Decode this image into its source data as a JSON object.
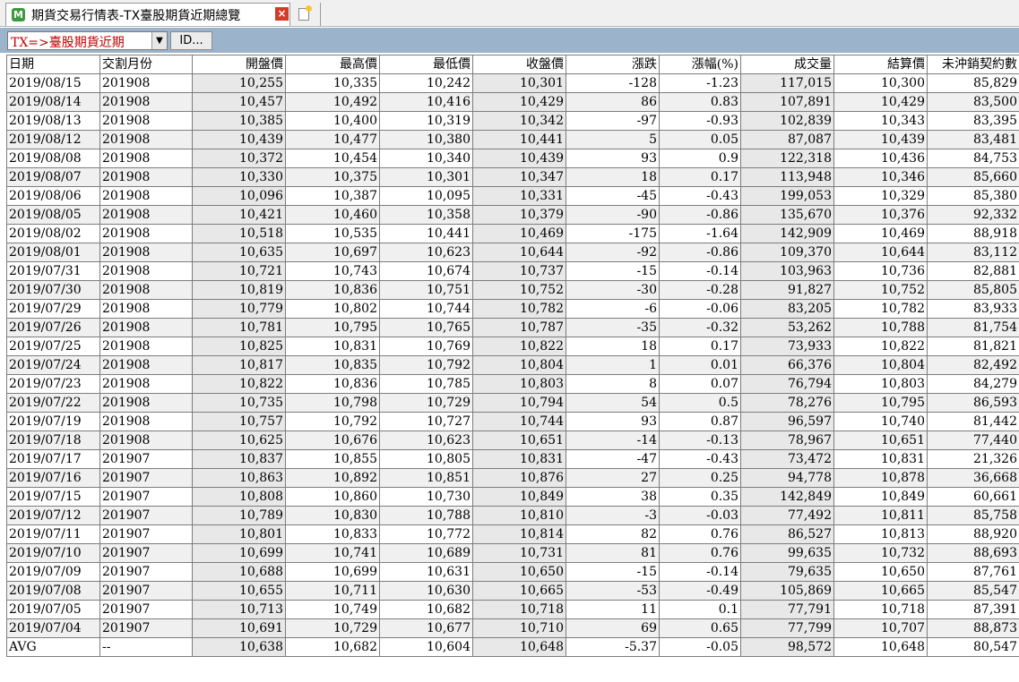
{
  "window": {
    "tab_title": "期貨交易行情表-TX臺股期貨近期總覽",
    "tab_icon": "M",
    "close_glyph": "×"
  },
  "toolbar": {
    "contract_select_value": "TX=>臺股期貨近期",
    "dropdown_arrow": "▼",
    "id_button_label": "ID..."
  },
  "table": {
    "columns": [
      "日期",
      "交割月份",
      "開盤價",
      "最高價",
      "最低價",
      "收盤價",
      "漲跌",
      "漲幅(%)",
      "成交量",
      "結算價",
      "未沖銷契約數"
    ],
    "rows": [
      [
        "2019/08/15",
        "201908",
        "10,255",
        "10,335",
        "10,242",
        "10,301",
        "-128",
        "-1.23",
        "117,015",
        "10,300",
        "85,829"
      ],
      [
        "2019/08/14",
        "201908",
        "10,457",
        "10,492",
        "10,416",
        "10,429",
        "86",
        "0.83",
        "107,891",
        "10,429",
        "83,500"
      ],
      [
        "2019/08/13",
        "201908",
        "10,385",
        "10,400",
        "10,319",
        "10,342",
        "-97",
        "-0.93",
        "102,839",
        "10,343",
        "83,395"
      ],
      [
        "2019/08/12",
        "201908",
        "10,439",
        "10,477",
        "10,380",
        "10,441",
        "5",
        "0.05",
        "87,087",
        "10,439",
        "83,481"
      ],
      [
        "2019/08/08",
        "201908",
        "10,372",
        "10,454",
        "10,340",
        "10,439",
        "93",
        "0.9",
        "122,318",
        "10,436",
        "84,753"
      ],
      [
        "2019/08/07",
        "201908",
        "10,330",
        "10,375",
        "10,301",
        "10,347",
        "18",
        "0.17",
        "113,948",
        "10,346",
        "85,660"
      ],
      [
        "2019/08/06",
        "201908",
        "10,096",
        "10,387",
        "10,095",
        "10,331",
        "-45",
        "-0.43",
        "199,053",
        "10,329",
        "85,380"
      ],
      [
        "2019/08/05",
        "201908",
        "10,421",
        "10,460",
        "10,358",
        "10,379",
        "-90",
        "-0.86",
        "135,670",
        "10,376",
        "92,332"
      ],
      [
        "2019/08/02",
        "201908",
        "10,518",
        "10,535",
        "10,441",
        "10,469",
        "-175",
        "-1.64",
        "142,909",
        "10,469",
        "88,918"
      ],
      [
        "2019/08/01",
        "201908",
        "10,635",
        "10,697",
        "10,623",
        "10,644",
        "-92",
        "-0.86",
        "109,370",
        "10,644",
        "83,112"
      ],
      [
        "2019/07/31",
        "201908",
        "10,721",
        "10,743",
        "10,674",
        "10,737",
        "-15",
        "-0.14",
        "103,963",
        "10,736",
        "82,881"
      ],
      [
        "2019/07/30",
        "201908",
        "10,819",
        "10,836",
        "10,751",
        "10,752",
        "-30",
        "-0.28",
        "91,827",
        "10,752",
        "85,805"
      ],
      [
        "2019/07/29",
        "201908",
        "10,779",
        "10,802",
        "10,744",
        "10,782",
        "-6",
        "-0.06",
        "83,205",
        "10,782",
        "83,933"
      ],
      [
        "2019/07/26",
        "201908",
        "10,781",
        "10,795",
        "10,765",
        "10,787",
        "-35",
        "-0.32",
        "53,262",
        "10,788",
        "81,754"
      ],
      [
        "2019/07/25",
        "201908",
        "10,825",
        "10,831",
        "10,769",
        "10,822",
        "18",
        "0.17",
        "73,933",
        "10,822",
        "81,821"
      ],
      [
        "2019/07/24",
        "201908",
        "10,817",
        "10,835",
        "10,792",
        "10,804",
        "1",
        "0.01",
        "66,376",
        "10,804",
        "82,492"
      ],
      [
        "2019/07/23",
        "201908",
        "10,822",
        "10,836",
        "10,785",
        "10,803",
        "8",
        "0.07",
        "76,794",
        "10,803",
        "84,279"
      ],
      [
        "2019/07/22",
        "201908",
        "10,735",
        "10,798",
        "10,729",
        "10,794",
        "54",
        "0.5",
        "78,276",
        "10,795",
        "86,593"
      ],
      [
        "2019/07/19",
        "201908",
        "10,757",
        "10,792",
        "10,727",
        "10,744",
        "93",
        "0.87",
        "96,597",
        "10,740",
        "81,442"
      ],
      [
        "2019/07/18",
        "201908",
        "10,625",
        "10,676",
        "10,623",
        "10,651",
        "-14",
        "-0.13",
        "78,967",
        "10,651",
        "77,440"
      ],
      [
        "2019/07/17",
        "201907",
        "10,837",
        "10,855",
        "10,805",
        "10,831",
        "-47",
        "-0.43",
        "73,472",
        "10,831",
        "21,326"
      ],
      [
        "2019/07/16",
        "201907",
        "10,863",
        "10,892",
        "10,851",
        "10,876",
        "27",
        "0.25",
        "94,778",
        "10,878",
        "36,668"
      ],
      [
        "2019/07/15",
        "201907",
        "10,808",
        "10,860",
        "10,730",
        "10,849",
        "38",
        "0.35",
        "142,849",
        "10,849",
        "60,661"
      ],
      [
        "2019/07/12",
        "201907",
        "10,789",
        "10,830",
        "10,788",
        "10,810",
        "-3",
        "-0.03",
        "77,492",
        "10,811",
        "85,758"
      ],
      [
        "2019/07/11",
        "201907",
        "10,801",
        "10,833",
        "10,772",
        "10,814",
        "82",
        "0.76",
        "86,527",
        "10,813",
        "88,920"
      ],
      [
        "2019/07/10",
        "201907",
        "10,699",
        "10,741",
        "10,689",
        "10,731",
        "81",
        "0.76",
        "99,635",
        "10,732",
        "88,693"
      ],
      [
        "2019/07/09",
        "201907",
        "10,688",
        "10,699",
        "10,631",
        "10,650",
        "-15",
        "-0.14",
        "79,635",
        "10,650",
        "87,761"
      ],
      [
        "2019/07/08",
        "201907",
        "10,655",
        "10,711",
        "10,630",
        "10,665",
        "-53",
        "-0.49",
        "105,869",
        "10,665",
        "85,547"
      ],
      [
        "2019/07/05",
        "201907",
        "10,713",
        "10,749",
        "10,682",
        "10,718",
        "11",
        "0.1",
        "77,791",
        "10,718",
        "87,391"
      ],
      [
        "2019/07/04",
        "201907",
        "10,691",
        "10,729",
        "10,677",
        "10,710",
        "69",
        "0.65",
        "77,799",
        "10,707",
        "88,873"
      ],
      [
        "AVG",
        "--",
        "10,638",
        "10,682",
        "10,604",
        "10,648",
        "-5.37",
        "-0.05",
        "98,572",
        "10,648",
        "80,547"
      ]
    ]
  }
}
